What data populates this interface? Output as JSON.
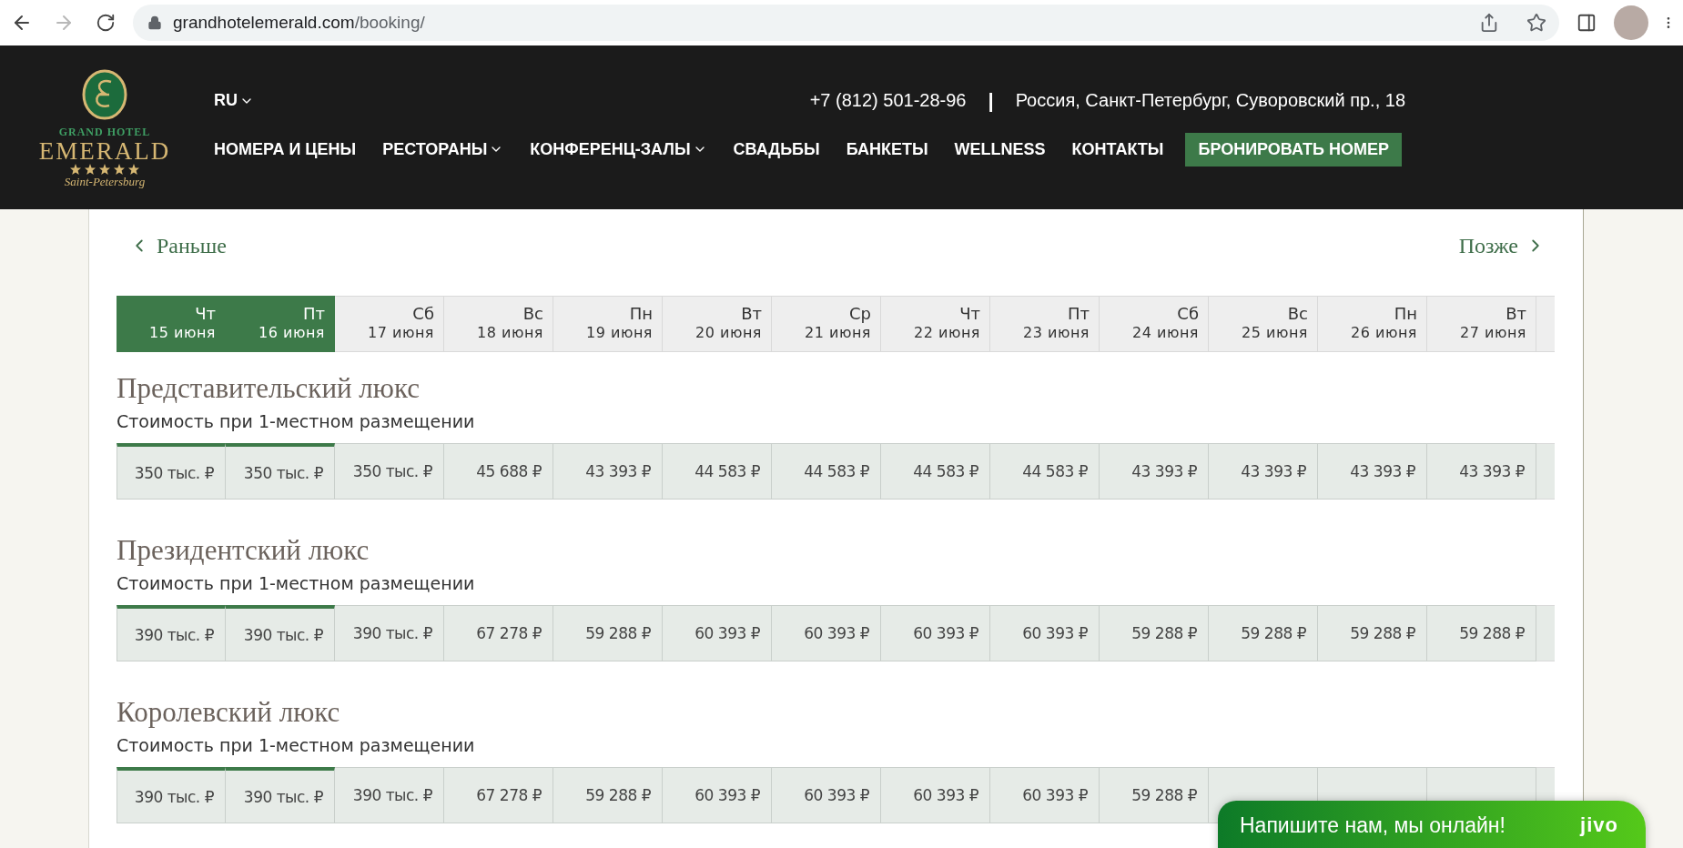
{
  "browser": {
    "back_enabled": true,
    "forward_enabled": false,
    "url_host": "grandhotelemerald.com",
    "url_path": "/booking/"
  },
  "header": {
    "logo": {
      "line1": "GRAND HOTEL",
      "line2": "EMERALD",
      "line3": "Saint-Petersburg"
    },
    "language": {
      "label": "RU",
      "dropdown": true
    },
    "phone": "+7 (812) 501-28-96",
    "separator": "|",
    "address": "Россия, Санкт-Петербург, Суворовский пр., 18",
    "nav": [
      {
        "label": "НОМЕРА И ЦЕНЫ",
        "dropdown": false
      },
      {
        "label": "РЕСТОРАНЫ",
        "dropdown": true
      },
      {
        "label": "КОНФЕРЕНЦ-ЗАЛЫ",
        "dropdown": true
      },
      {
        "label": "СВАДЬБЫ",
        "dropdown": false
      },
      {
        "label": "БАНКЕТЫ",
        "dropdown": false
      },
      {
        "label": "WELLNESS",
        "dropdown": false
      },
      {
        "label": "КОНТАКТЫ",
        "dropdown": false
      }
    ],
    "cta": "БРОНИРОВАТЬ НОМЕР"
  },
  "pager": {
    "prev": "Раньше",
    "next": "Позже"
  },
  "dates": [
    {
      "weekday": "Чт",
      "date": "15 июня",
      "selected": true
    },
    {
      "weekday": "Пт",
      "date": "16 июня",
      "selected": true
    },
    {
      "weekday": "Сб",
      "date": "17 июня",
      "selected": false
    },
    {
      "weekday": "Вс",
      "date": "18 июня",
      "selected": false
    },
    {
      "weekday": "Пн",
      "date": "19 июня",
      "selected": false
    },
    {
      "weekday": "Вт",
      "date": "20 июня",
      "selected": false
    },
    {
      "weekday": "Ср",
      "date": "21 июня",
      "selected": false
    },
    {
      "weekday": "Чт",
      "date": "22 июня",
      "selected": false
    },
    {
      "weekday": "Пт",
      "date": "23 июня",
      "selected": false
    },
    {
      "weekday": "Сб",
      "date": "24 июня",
      "selected": false
    },
    {
      "weekday": "Вс",
      "date": "25 июня",
      "selected": false
    },
    {
      "weekday": "Пн",
      "date": "26 июня",
      "selected": false
    },
    {
      "weekday": "Вт",
      "date": "27 июня",
      "selected": false
    }
  ],
  "rooms": [
    {
      "title": "Представительский люкс",
      "subtitle": "Стоимость при 1-местном размещении",
      "prices": [
        "350 тыс. ₽",
        "350 тыс. ₽",
        "350 тыс. ₽",
        "45 688 ₽",
        "43 393 ₽",
        "44 583 ₽",
        "44 583 ₽",
        "44 583 ₽",
        "44 583 ₽",
        "43 393 ₽",
        "43 393 ₽",
        "43 393 ₽",
        "43 393 ₽"
      ]
    },
    {
      "title": "Президентский люкс",
      "subtitle": "Стоимость при 1-местном размещении",
      "prices": [
        "390 тыс. ₽",
        "390 тыс. ₽",
        "390 тыс. ₽",
        "67 278 ₽",
        "59 288 ₽",
        "60 393 ₽",
        "60 393 ₽",
        "60 393 ₽",
        "60 393 ₽",
        "59 288 ₽",
        "59 288 ₽",
        "59 288 ₽",
        "59 288 ₽"
      ]
    },
    {
      "title": "Королевский люкс",
      "subtitle": "Стоимость при 1-местном размещении",
      "prices": [
        "390 тыс. ₽",
        "390 тыс. ₽",
        "390 тыс. ₽",
        "67 278 ₽",
        "59 288 ₽",
        "60 393 ₽",
        "60 393 ₽",
        "60 393 ₽",
        "60 393 ₽",
        "59 288 ₽"
      ]
    }
  ],
  "chat": {
    "text": "Напишите нам, мы онлайн!",
    "brand": "jivo"
  }
}
